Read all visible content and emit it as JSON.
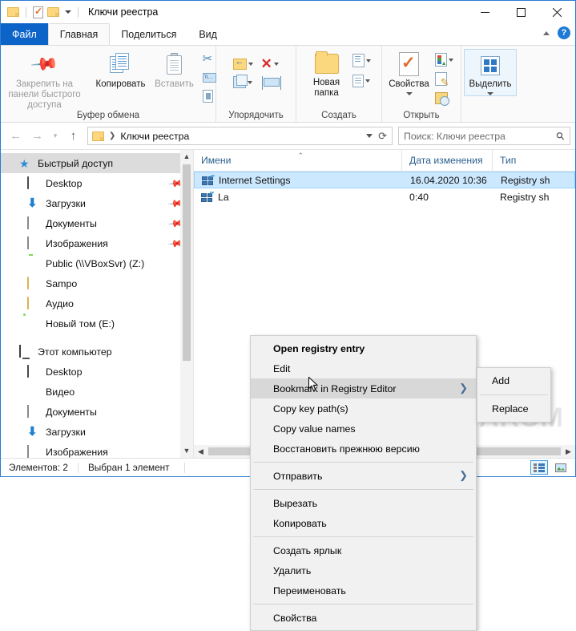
{
  "window": {
    "title": "Ключи реестра",
    "quick_access": [
      "folder-icon",
      "properties-icon",
      "folder-icon"
    ],
    "controls": {
      "minimize": "minimize-icon",
      "maximize": "maximize-icon",
      "close": "close-icon"
    }
  },
  "ribbon": {
    "tabs": [
      {
        "label": "Файл",
        "kind": "file"
      },
      {
        "label": "Главная",
        "kind": "active"
      },
      {
        "label": "Поделиться",
        "kind": "normal"
      },
      {
        "label": "Вид",
        "kind": "normal"
      }
    ],
    "help_label": "?",
    "groups": [
      {
        "label": "Буфер обмена",
        "buttons": [
          {
            "label": "Закрепить на панели быстрого доступа",
            "icon": "pin-icon",
            "dim": true
          },
          {
            "label": "Копировать",
            "icon": "copy-icon",
            "dim": false
          },
          {
            "label": "Вставить",
            "icon": "paste-icon",
            "dim": true
          }
        ],
        "small": [
          "cut-icon",
          "copy-path-icon",
          "paste-shortcut-icon"
        ]
      },
      {
        "label": "Упорядочить",
        "small": [
          "move-to-icon",
          "delete-icon",
          "copy-to-icon",
          "rename-icon"
        ]
      },
      {
        "label": "Создать",
        "buttons": [
          {
            "label": "Новая папка",
            "icon": "new-folder-icon",
            "dim": false
          }
        ],
        "small": [
          "new-item-icon",
          "easy-access-icon"
        ]
      },
      {
        "label": "Открыть",
        "buttons": [
          {
            "label": "Свойства",
            "icon": "properties-icon",
            "dim": false
          }
        ],
        "small": [
          "open-icon",
          "edit-icon",
          "history-icon"
        ]
      },
      {
        "label": "",
        "buttons": [
          {
            "label": "Выделить",
            "icon": "select-all-icon",
            "dim": false
          }
        ]
      }
    ]
  },
  "address_bar": {
    "back": "back-arrow-icon",
    "forward": "forward-arrow-icon",
    "recent": "chevron-down-icon",
    "up": "up-arrow-icon",
    "crumb_root_icon": "folder-icon",
    "crumb": "Ключи реестра",
    "dropdown": "chevron-down-icon",
    "refresh": "refresh-icon"
  },
  "search": {
    "placeholder": "Поиск: Ключи реестра",
    "icon": "search-icon"
  },
  "sidebar": {
    "items": [
      {
        "label": "Быстрый доступ",
        "icon": "star-icon",
        "level": 1,
        "selected": true,
        "pinned": false
      },
      {
        "label": "Desktop",
        "icon": "desktop-icon",
        "level": 2,
        "selected": false,
        "pinned": true
      },
      {
        "label": "Загрузки",
        "icon": "downloads-icon",
        "level": 2,
        "selected": false,
        "pinned": true
      },
      {
        "label": "Документы",
        "icon": "documents-icon",
        "level": 2,
        "selected": false,
        "pinned": true
      },
      {
        "label": "Изображения",
        "icon": "pictures-icon",
        "level": 2,
        "selected": false,
        "pinned": true
      },
      {
        "label": "Public (\\\\VBoxSvr) (Z:)",
        "icon": "network-drive-icon",
        "level": 2,
        "selected": false,
        "pinned": false
      },
      {
        "label": "Sampo",
        "icon": "folder-icon",
        "level": 2,
        "selected": false,
        "pinned": false
      },
      {
        "label": "Аудио",
        "icon": "folder-icon",
        "level": 2,
        "selected": false,
        "pinned": false
      },
      {
        "label": "Новый том (E:)",
        "icon": "drive-icon",
        "level": 2,
        "selected": false,
        "pinned": false
      },
      {
        "label": "Этот компьютер",
        "icon": "computer-icon",
        "level": 1,
        "selected": false,
        "pinned": false
      },
      {
        "label": "Desktop",
        "icon": "desktop-icon",
        "level": 2,
        "selected": false,
        "pinned": false
      },
      {
        "label": "Видео",
        "icon": "video-icon",
        "level": 2,
        "selected": false,
        "pinned": false
      },
      {
        "label": "Документы",
        "icon": "documents-icon",
        "level": 2,
        "selected": false,
        "pinned": false
      },
      {
        "label": "Загрузки",
        "icon": "downloads-icon",
        "level": 2,
        "selected": false,
        "pinned": false
      },
      {
        "label": "Изображения",
        "icon": "pictures-icon",
        "level": 2,
        "selected": false,
        "pinned": false
      }
    ]
  },
  "file_list": {
    "columns": [
      {
        "label": "Имени",
        "sorted": true
      },
      {
        "label": "Дата изменения",
        "sorted": false
      },
      {
        "label": "Тип",
        "sorted": false
      }
    ],
    "rows": [
      {
        "name": "Internet Settings",
        "date": "16.04.2020 10:36",
        "type": "Registry sh",
        "icon": "registry-shortcut-icon",
        "selected": true
      },
      {
        "name": "La",
        "date": "0:40",
        "type": "Registry sh",
        "icon": "registry-shortcut-icon",
        "selected": false
      }
    ]
  },
  "context_menu": {
    "items": [
      {
        "label": "Open registry entry",
        "bold": true,
        "submenu": false,
        "hover": false
      },
      {
        "label": "Edit",
        "bold": false,
        "submenu": false,
        "hover": false
      },
      {
        "label": "Bookmark in Registry Editor",
        "bold": false,
        "submenu": true,
        "hover": true
      },
      {
        "label": "Copy key path(s)",
        "bold": false,
        "submenu": false,
        "hover": false
      },
      {
        "label": "Copy value names",
        "bold": false,
        "submenu": false,
        "hover": false
      },
      {
        "label": "Восстановить прежнюю версию",
        "bold": false,
        "submenu": false,
        "hover": false
      },
      {
        "separator": true
      },
      {
        "label": "Отправить",
        "bold": false,
        "submenu": true,
        "hover": false
      },
      {
        "separator": true
      },
      {
        "label": "Вырезать",
        "bold": false,
        "submenu": false,
        "hover": false
      },
      {
        "label": "Копировать",
        "bold": false,
        "submenu": false,
        "hover": false
      },
      {
        "separator": true
      },
      {
        "label": "Создать ярлык",
        "bold": false,
        "submenu": false,
        "hover": false
      },
      {
        "label": "Удалить",
        "bold": false,
        "submenu": false,
        "hover": false
      },
      {
        "label": "Переименовать",
        "bold": false,
        "submenu": false,
        "hover": false
      },
      {
        "separator": true
      },
      {
        "label": "Свойства",
        "bold": false,
        "submenu": false,
        "hover": false
      }
    ],
    "submenu_arrow": "chevron-right-icon"
  },
  "submenu": {
    "items": [
      {
        "label": "Add"
      },
      {
        "label": "Replace"
      }
    ]
  },
  "status_bar": {
    "count_text": "Элементов: 2",
    "selection_text": "Выбран 1 элемент",
    "view_details": "details-view-icon",
    "view_large": "large-icons-view-icon"
  },
  "watermark": {
    "text": "VIARUM"
  },
  "colors": {
    "accent": "#0c64c8",
    "selection": "#cce8ff",
    "hover": "#d8d8d8",
    "column_header_text": "#2b5f8f"
  }
}
